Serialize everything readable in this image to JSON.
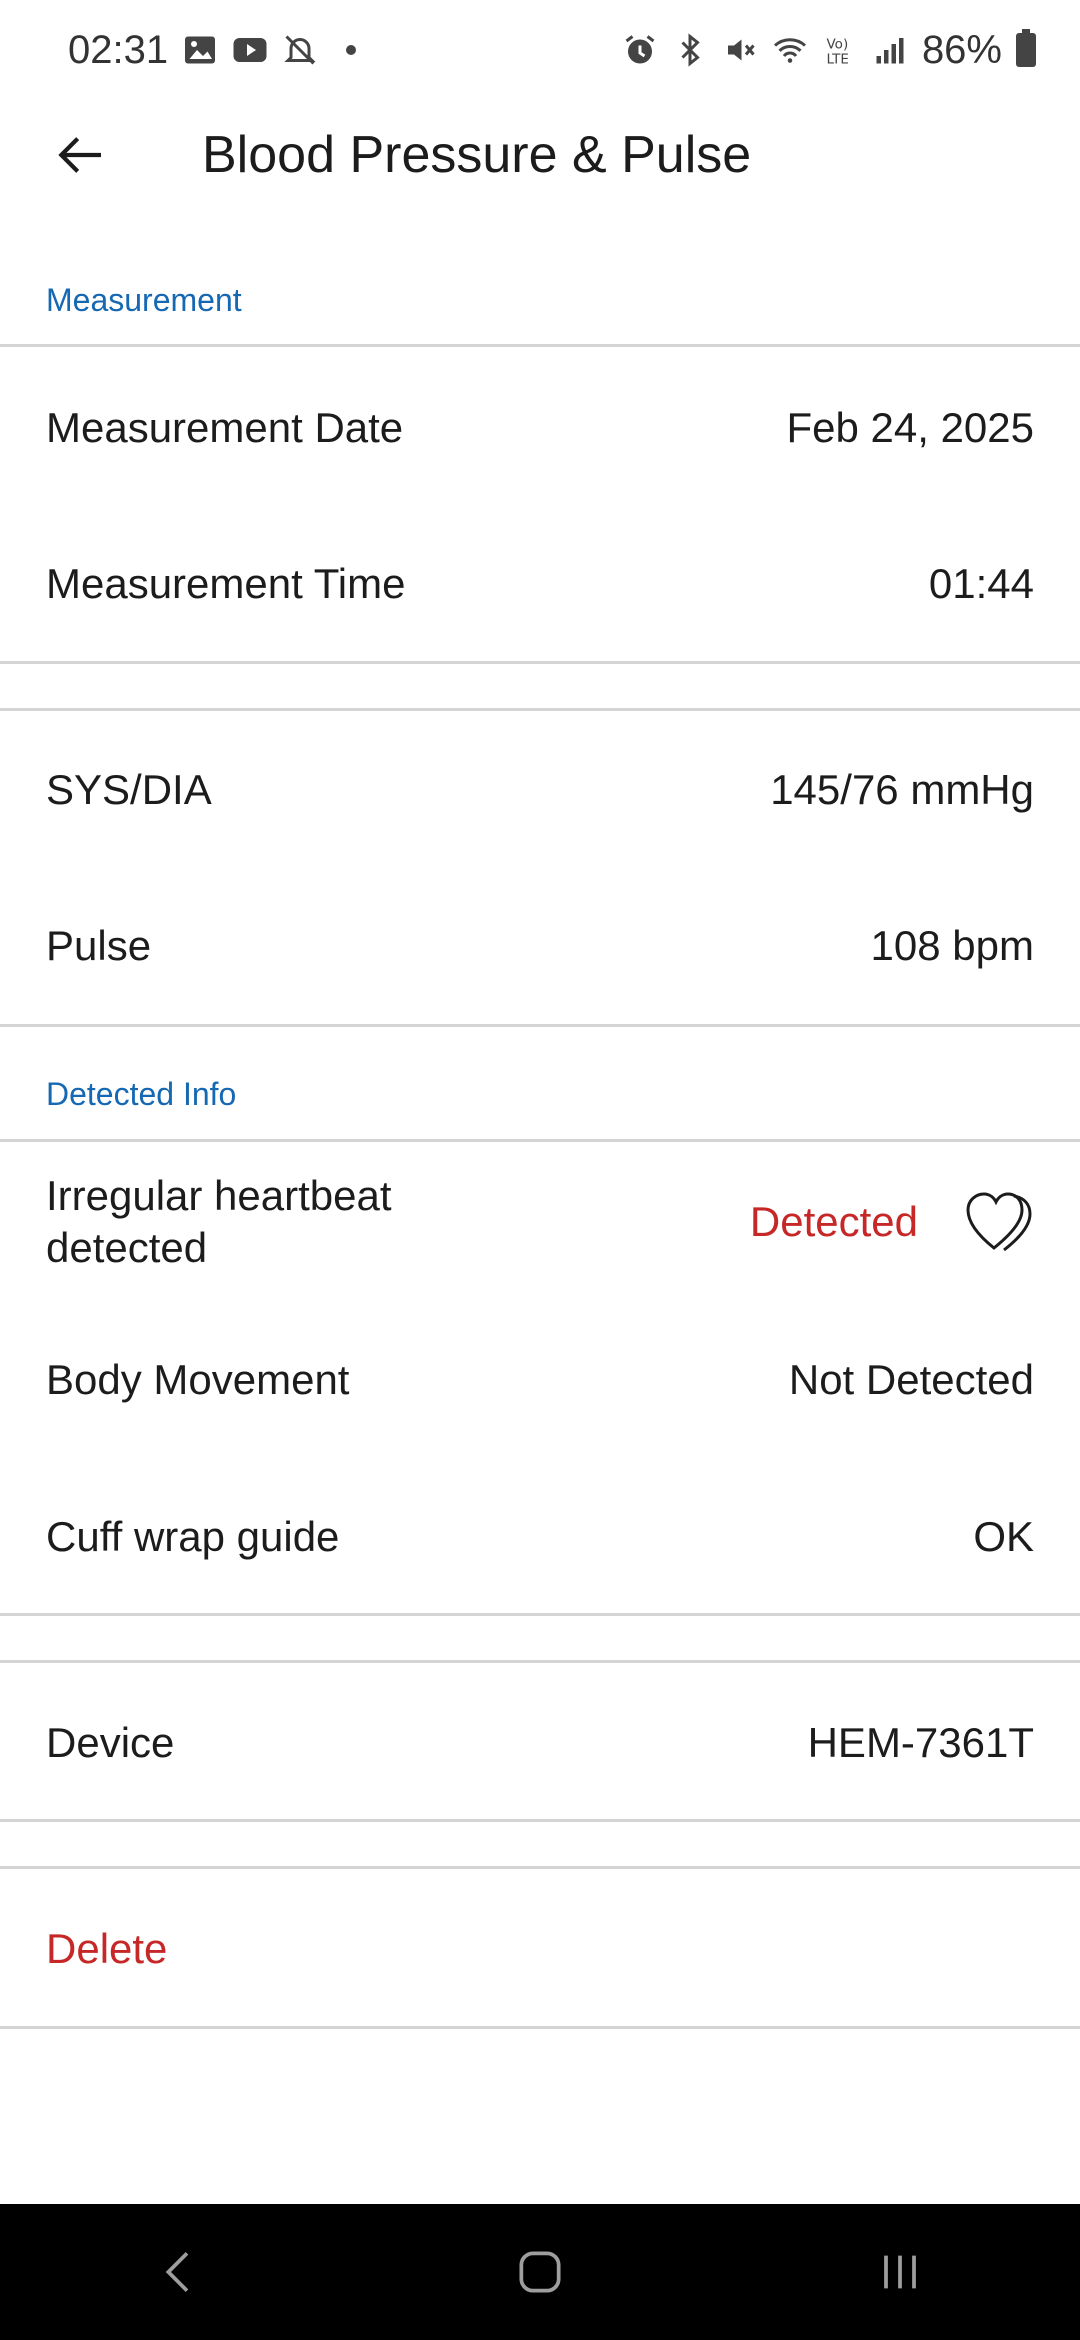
{
  "status_bar": {
    "time": "02:31",
    "battery": "86%",
    "left_icons": [
      "gallery-icon",
      "youtube-icon",
      "notifications-off-icon"
    ],
    "right_icons": [
      "alarm-icon",
      "bluetooth-icon",
      "mute-icon",
      "wifi-icon",
      "volte-icon",
      "signal-icon",
      "battery-icon"
    ]
  },
  "app_bar": {
    "title": "Blood Pressure & Pulse"
  },
  "sections": {
    "measurement": {
      "header": "Measurement",
      "date_label": "Measurement Date",
      "date_value": "Feb 24, 2025",
      "time_label": "Measurement Time",
      "time_value": "01:44"
    },
    "readings": {
      "sysdia_label": "SYS/DIA",
      "sysdia_value": "145/76 mmHg",
      "pulse_label": "Pulse",
      "pulse_value": "108 bpm"
    },
    "detected_info": {
      "header": "Detected Info",
      "irregular_label_line1": "Irregular heartbeat",
      "irregular_label_line2": "detected",
      "irregular_value": "Detected",
      "body_movement_label": "Body Movement",
      "body_movement_value": "Not Detected",
      "cuff_label": "Cuff wrap guide",
      "cuff_value": "OK"
    },
    "device": {
      "label": "Device",
      "value": "HEM-7361T"
    },
    "actions": {
      "delete_label": "Delete"
    }
  },
  "colors": {
    "accent_blue": "#1668b3",
    "alert_red": "#c62828",
    "divider": "#d4d4d4",
    "nav_bar": "#000000"
  },
  "nav_bar": {
    "icons": [
      "back-nav-icon",
      "home-nav-icon",
      "recents-nav-icon"
    ]
  }
}
